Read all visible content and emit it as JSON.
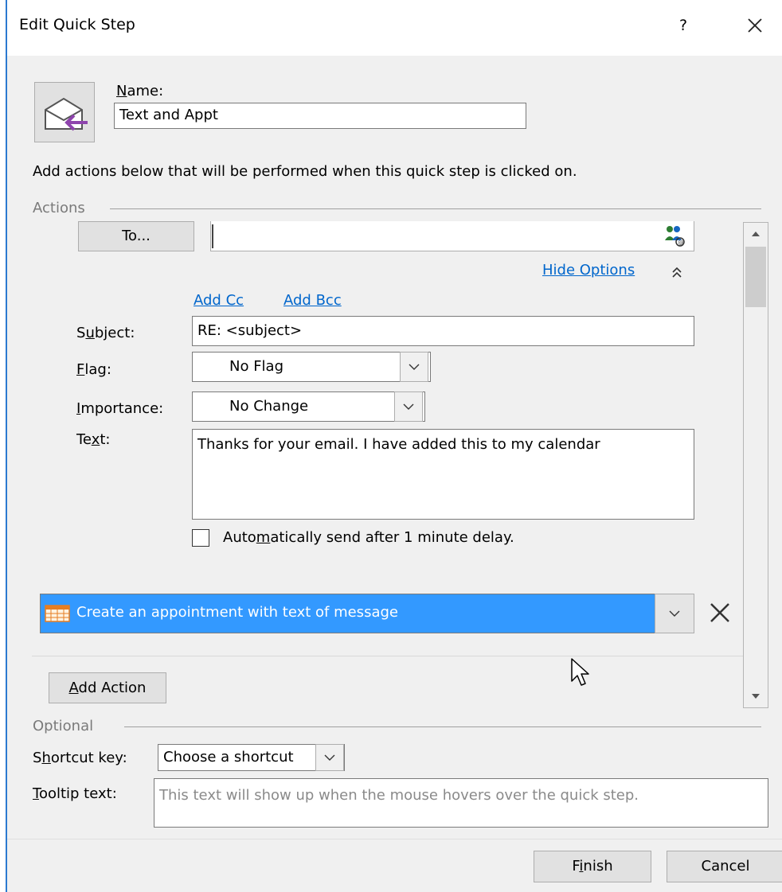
{
  "window": {
    "title": "Edit Quick Step",
    "help_label": "?",
    "accent_color": "#2b79d0"
  },
  "header": {
    "icon": "mail-reply-icon",
    "name_label": "Name:",
    "name_value": "Text and Appt",
    "instructions": "Add actions below that will be performed when this quick step is clicked on."
  },
  "actions_group": {
    "title": "Actions",
    "to_button": "To...",
    "to_value": "",
    "address_book_icon": "address-book-icon",
    "hide_options_link": "Hide Options",
    "add_cc_link": "Add Cc",
    "add_bcc_link": "Add Bcc",
    "subject_label": "Subject:",
    "subject_value": "RE: <subject>",
    "flag_label": "Flag:",
    "flag_value": "No Flag",
    "importance_label": "Importance:",
    "importance_value": "No Change",
    "text_label": "Text:",
    "text_value": "Thanks for your email. I have added this to my calendar",
    "auto_send_label": "Automatically send after 1 minute delay.",
    "auto_send_checked": false,
    "selected_action": "Create an appointment with text of message",
    "selected_color": "#3399ff",
    "add_action_button": "Add Action"
  },
  "optional_group": {
    "title": "Optional",
    "shortcut_label": "Shortcut key:",
    "shortcut_value": "Choose a shortcut",
    "tooltip_label": "Tooltip text:",
    "tooltip_placeholder": "This text will show up when the mouse hovers over the quick step."
  },
  "footer": {
    "finish_button": "Finish",
    "cancel_button": "Cancel"
  }
}
